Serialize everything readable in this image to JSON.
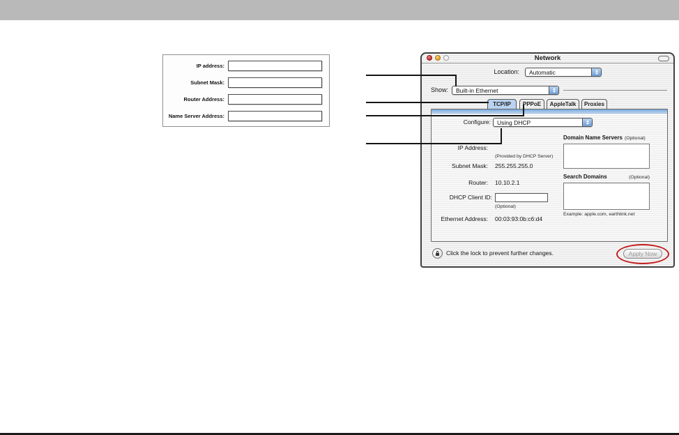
{
  "colors": {
    "top-bar": "#b9b9b9",
    "accent-blue": "#6f9fd8",
    "tab-selected": "#b9d3f0",
    "annotation-red": "#c41f1f",
    "line-black": "#141414"
  },
  "form": {
    "fields": [
      {
        "label": "IP address:",
        "value": ""
      },
      {
        "label": "Subnet Mask:",
        "value": ""
      },
      {
        "label": "Router Address:",
        "value": ""
      },
      {
        "label": "Name Server Address:",
        "value": ""
      }
    ]
  },
  "win": {
    "title": "Network",
    "location": {
      "label": "Location:",
      "value": "Automatic"
    },
    "show": {
      "label": "Show:",
      "value": "Built-in Ethernet"
    },
    "tabs": [
      {
        "label": "TCP/IP"
      },
      {
        "label": "PPPoE"
      },
      {
        "label": "AppleTalk"
      },
      {
        "label": "Proxies"
      }
    ],
    "configure": {
      "label": "Configure:",
      "value": "Using DHCP"
    },
    "fields": {
      "ip": {
        "label": "IP Address:",
        "note": "(Provided by DHCP Server)"
      },
      "subnet": {
        "label": "Subnet Mask:",
        "value": "255.255.255.0"
      },
      "router": {
        "label": "Router:",
        "value": "10.10.2.1"
      },
      "dhcp_client": {
        "label": "DHCP Client ID:",
        "value": "",
        "note": "(Optional)"
      },
      "ethernet": {
        "label": "Ethernet Address:",
        "value": "00:03:93:0b:c6:d4"
      }
    },
    "dns": {
      "label": "Domain Name Servers",
      "optional": "(Optional)"
    },
    "search_domains": {
      "label": "Search Domains",
      "optional": "(Optional)",
      "example": "Example: apple.com, earthlink.net"
    },
    "footer": {
      "lock_text": "Click the lock to prevent further changes.",
      "apply_label": "Apply Now"
    }
  }
}
